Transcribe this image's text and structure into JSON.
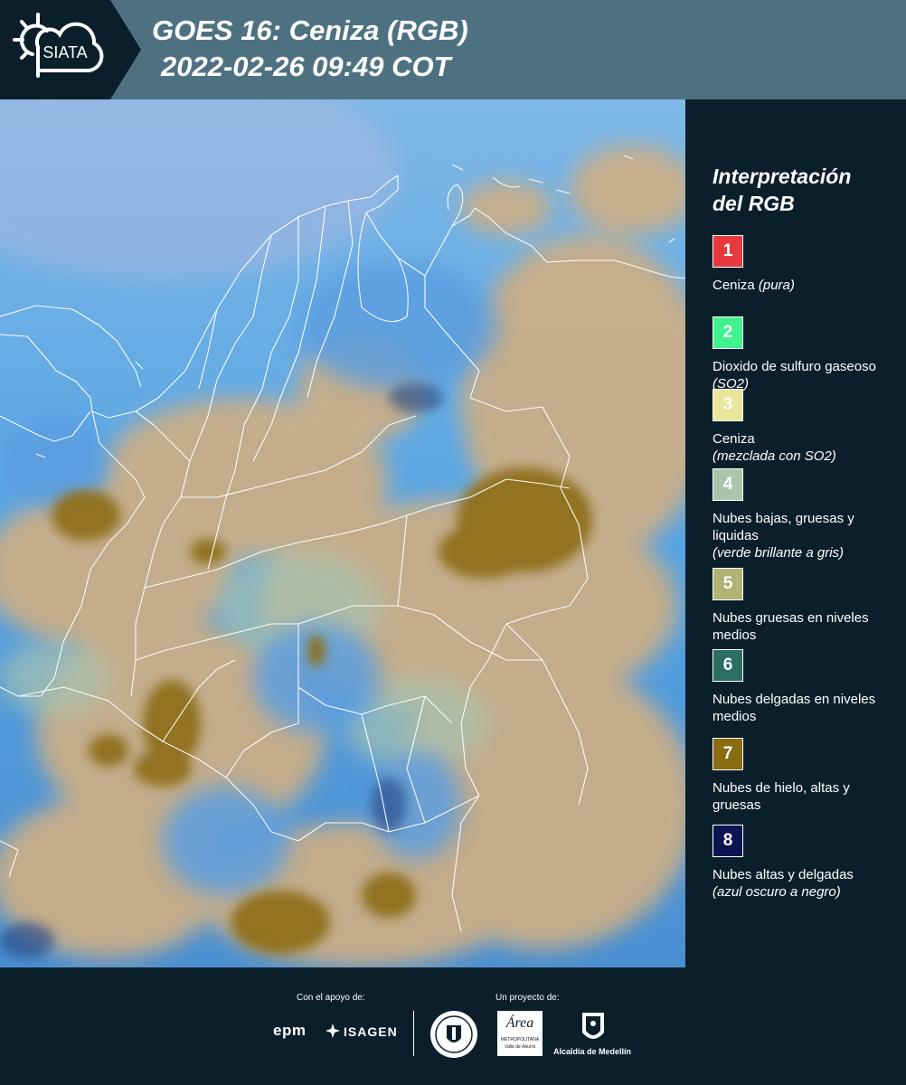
{
  "header": {
    "logo_text": "SIATA",
    "title": "GOES 16: Ceniza (RGB)",
    "datetime": "2022-02-26 09:49 COT"
  },
  "legend": {
    "title_line1": "Interpretación",
    "title_line2": "del RGB",
    "items": [
      {
        "number": "1",
        "color": "#e83a3e",
        "label": "Ceniza ",
        "note": "(pura)",
        "label2": ""
      },
      {
        "number": "2",
        "color": "#3ff28c",
        "label": "Dioxido de sulfuro gaseoso ",
        "note": "(SO2)",
        "label2": ""
      },
      {
        "number": "3",
        "color": "#e8e69a",
        "label": "Ceniza",
        "note": "(mezclada con SO2)",
        "label2": ""
      },
      {
        "number": "4",
        "color": "#a9c6ac",
        "label": "Nubes bajas, gruesas y liquidas",
        "note": "(verde brillante a gris)",
        "label2": ""
      },
      {
        "number": "5",
        "color": "#b1b274",
        "label": "Nubes gruesas en niveles medios",
        "note": "",
        "label2": ""
      },
      {
        "number": "6",
        "color": "#2b6f63",
        "label": "Nubes delgadas en niveles medios",
        "note": "",
        "label2": ""
      },
      {
        "number": "7",
        "color": "#8a6c12",
        "label": "Nubes de hielo, altas y gruesas",
        "note": "",
        "label2": ""
      },
      {
        "number": "8",
        "color": "#0d1452",
        "label": "Nubes altas y delgadas",
        "note": "(azul oscuro a negro)",
        "label2": ""
      }
    ]
  },
  "footer": {
    "support_label": "Con el apoyo de:",
    "project_label": "Un proyecto de:",
    "logos": {
      "epm": "epm",
      "isagen": "ISAGEN",
      "area_line1": "Área",
      "area_line2": "METROPOLITANA",
      "area_line3": "Valle de Aburrá",
      "alcaldia": "Alcaldía de Medellín"
    }
  },
  "colors": {
    "background": "#0b1f2b",
    "header": "#4e7181",
    "ocean_blue": "#6aa9d8",
    "cloud_tan": "#c9ae88",
    "ice_cloud": "#8a6c12"
  }
}
